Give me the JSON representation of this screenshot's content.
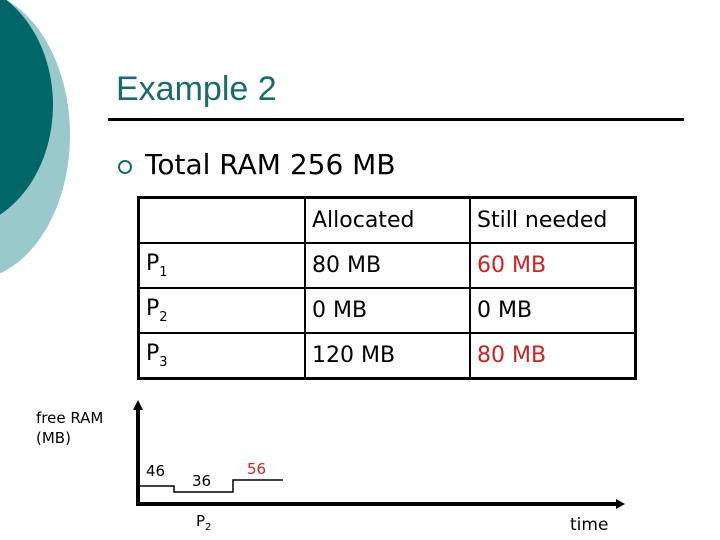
{
  "slide": {
    "title": "Example 2",
    "bullet": "Total RAM 256 MB",
    "colors": {
      "title": "#1a6b6b",
      "accent_dark": "#006666",
      "accent_light": "#99c9cb",
      "highlight": "#cc2222"
    }
  },
  "table": {
    "headers": [
      "",
      "Allocated",
      "Still needed"
    ],
    "rows": [
      {
        "proc": "P",
        "sub": "1",
        "allocated": "80 MB",
        "needed": "60 MB",
        "needed_highlight": true
      },
      {
        "proc": "P",
        "sub": "2",
        "allocated": "0 MB",
        "needed": "0 MB",
        "needed_highlight": false
      },
      {
        "proc": "P",
        "sub": "3",
        "allocated": "120 MB",
        "needed": "80 MB",
        "needed_highlight": true
      }
    ]
  },
  "graph": {
    "ylabel_line1": "free RAM",
    "ylabel_line2": "(MB)",
    "xlabel": "time",
    "steps": [
      {
        "label": "46",
        "value": 46,
        "highlight": false
      },
      {
        "label": "36",
        "value": 36,
        "highlight": false
      },
      {
        "label": "56",
        "value": 56,
        "highlight": true
      }
    ],
    "event_label": "P",
    "event_sub": "2"
  }
}
